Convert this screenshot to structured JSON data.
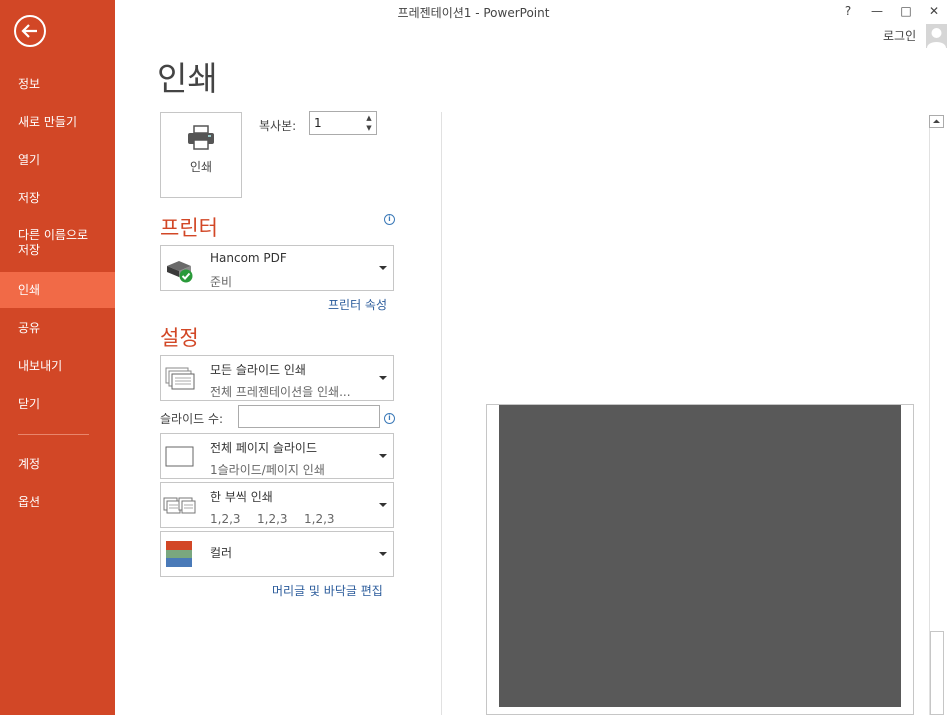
{
  "window": {
    "title": "프레젠테이션1 - PowerPoint",
    "help": "?",
    "minimize": "—",
    "maximize": "□",
    "close": "✕",
    "login": "로그인"
  },
  "sidebar": {
    "items": [
      {
        "label": "정보"
      },
      {
        "label": "새로 만들기"
      },
      {
        "label": "열기"
      },
      {
        "label": "저장"
      },
      {
        "label": "다른 이름으로\n저장"
      },
      {
        "label": "인쇄",
        "active": true
      },
      {
        "label": "공유"
      },
      {
        "label": "내보내기"
      },
      {
        "label": "닫기"
      },
      {
        "label": "계정"
      },
      {
        "label": "옵션"
      }
    ],
    "colors": {
      "background": "#d24726",
      "active": "#f16a47"
    }
  },
  "page_title": "인쇄",
  "print": {
    "button_label": "인쇄",
    "copies_label": "복사본:",
    "copies_value": "1"
  },
  "printer": {
    "heading": "프린터",
    "name": "Hancom PDF",
    "status": "준비",
    "properties_link": "프린터 속성"
  },
  "settings": {
    "heading": "설정",
    "range": {
      "main": "모든 슬라이드 인쇄",
      "sub": "전체 프레젠테이션을 인쇄..."
    },
    "slides_label": "슬라이드 수:",
    "slides_value": "",
    "layout": {
      "main": "전체 페이지 슬라이드",
      "sub": "1슬라이드/페이지 인쇄"
    },
    "collate": {
      "main": "한 부씩 인쇄",
      "sub": [
        "1,2,3",
        "1,2,3",
        "1,2,3"
      ]
    },
    "color": {
      "main": "컬러"
    },
    "header_footer_link": "머리글 및 바닥글 편집"
  },
  "accent_colors": {
    "heading": "#d24726",
    "link": "#2a5b9b",
    "slide_preview": "#595959"
  }
}
